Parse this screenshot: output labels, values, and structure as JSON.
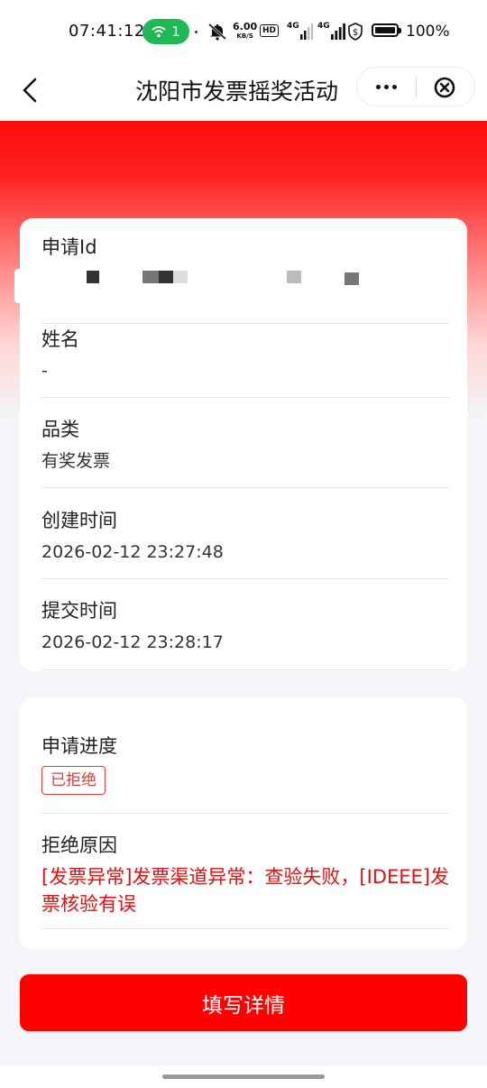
{
  "status_bar": {
    "time": "07:41:12",
    "wifi_count": "1",
    "net_speed_value": "6.00",
    "net_speed_unit": "KB/S",
    "hd_label": "HD",
    "network_1": "4G",
    "network_2": "4G",
    "battery_percent": "100%"
  },
  "nav": {
    "title": "沈阳市发票摇奖活动"
  },
  "details": {
    "application_id_label": "申请Id",
    "name_label": "姓名",
    "name_value": "-",
    "category_label": "品类",
    "category_value": "有奖发票",
    "created_label": "创建时间",
    "created_value": "2026-02-12 23:27:48",
    "submitted_label": "提交时间",
    "submitted_value": "2026-02-12 23:28:17"
  },
  "progress": {
    "progress_label": "申请进度",
    "status_badge": "已拒绝",
    "reason_label": "拒绝原因",
    "reason_value": "[发票异常]发票渠道异常：查验失败，[IDEEE]发票核验有误"
  },
  "actions": {
    "fill_details_button": "填写详情"
  },
  "colors": {
    "brand_red": "#ff0000",
    "reject_red": "#e53a3a",
    "wifi_green": "#1fb954"
  }
}
